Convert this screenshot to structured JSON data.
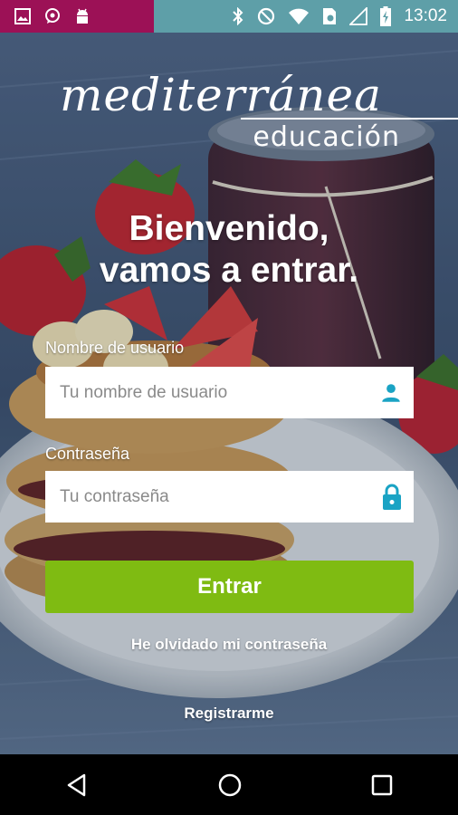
{
  "status_bar": {
    "time": "13:02",
    "left_color": "#9c1156",
    "right_color": "#5e9fa8",
    "icons_left": [
      "gallery-icon",
      "whatsapp-icon",
      "android-icon"
    ],
    "icons_right": [
      "bluetooth-icon",
      "do-not-disturb-icon",
      "wifi-icon",
      "sim-icon",
      "signal-icon",
      "battery-icon"
    ]
  },
  "brand": {
    "name": "mediterránea",
    "tagline": "educación"
  },
  "welcome": {
    "line1": "Bienvenido,",
    "line2": "vamos a entrar."
  },
  "form": {
    "username_label": "Nombre de usuario",
    "username_placeholder": "Tu nombre de usuario",
    "username_value": "",
    "password_label": "Contraseña",
    "password_placeholder": "Tu contraseña",
    "password_value": "",
    "submit_label": "Entrar",
    "accent_color": "#7fbb12",
    "icon_color": "#1aa3c4"
  },
  "links": {
    "forgot_password": "He olvidado mi contraseña",
    "register": "Registrarme"
  },
  "nav_bar": {
    "icons": [
      "back-icon",
      "home-icon",
      "recents-icon"
    ]
  }
}
